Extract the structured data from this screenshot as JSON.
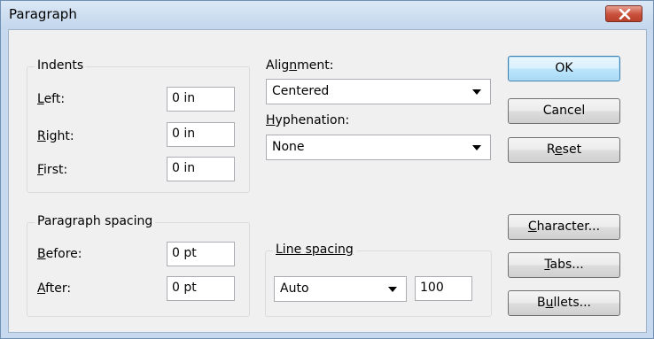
{
  "window": {
    "title": "Paragraph"
  },
  "indents": {
    "legend": "Indents",
    "left": {
      "pre": "",
      "key": "L",
      "post": "eft:",
      "value": "0 in"
    },
    "right": {
      "pre": "",
      "key": "R",
      "post": "ight:",
      "value": "0 in"
    },
    "first": {
      "pre": "",
      "key": "F",
      "post": "irst:",
      "value": "0 in"
    }
  },
  "alignment": {
    "pre": "Alig",
    "key": "n",
    "post": "ment:",
    "value": "Centered"
  },
  "hyphenation": {
    "pre": "",
    "key": "H",
    "post": "yphenation:",
    "value": "None"
  },
  "paragraph_spacing": {
    "legend": "Paragraph spacing",
    "before": {
      "pre": "",
      "key": "B",
      "post": "efore:",
      "value": "0 pt"
    },
    "after": {
      "pre": "",
      "key": "A",
      "post": "fter:",
      "value": "0 pt"
    }
  },
  "line_spacing": {
    "legend": "Line spacing",
    "mode": "Auto",
    "value": "100"
  },
  "buttons": {
    "ok": "OK",
    "cancel": "Cancel",
    "reset": {
      "pre": "R",
      "key": "e",
      "post": "set"
    },
    "character": {
      "pre": "",
      "key": "C",
      "post": "haracter..."
    },
    "tabs": {
      "pre": "",
      "key": "T",
      "post": "abs..."
    },
    "bullets": {
      "pre": "B",
      "key": "u",
      "post": "llets..."
    }
  },
  "icons": {
    "close": "close-icon",
    "dropdown": "chevron-down-icon"
  }
}
